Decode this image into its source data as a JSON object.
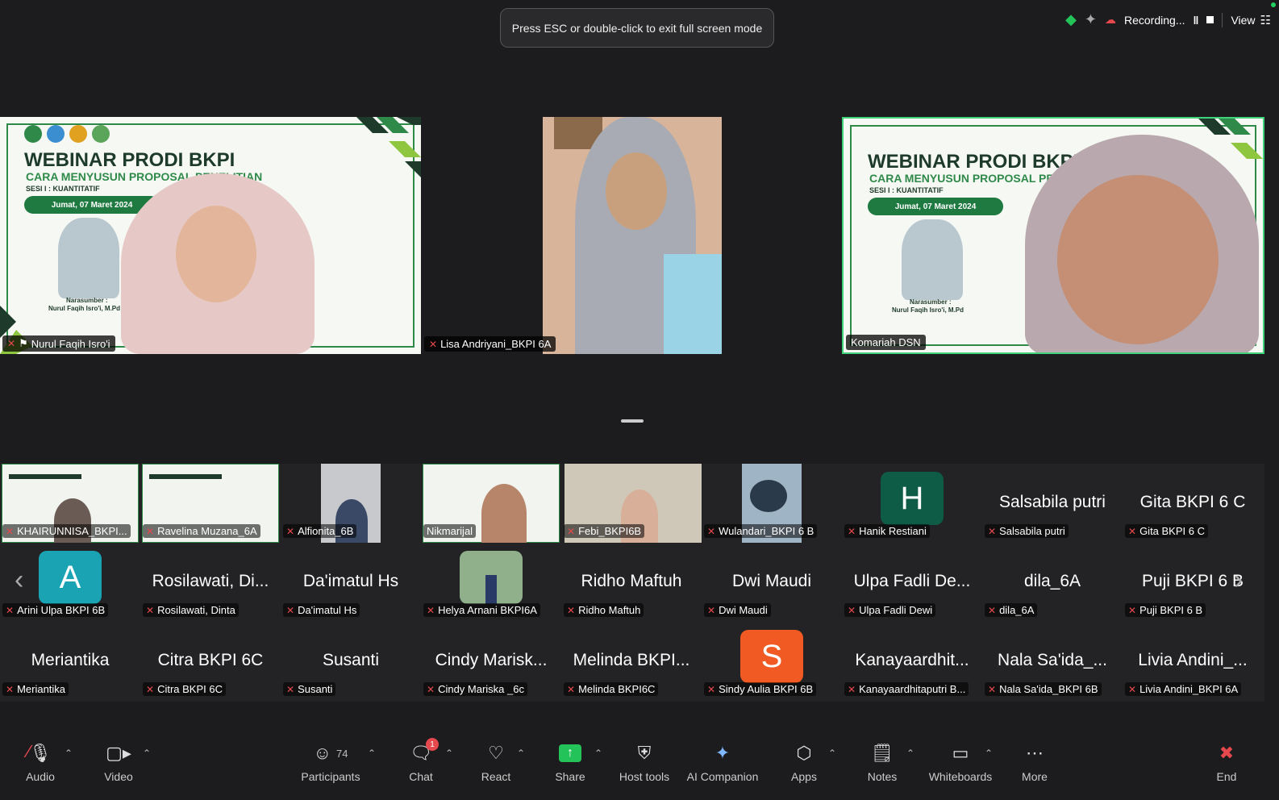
{
  "toast": "Press ESC or double-click to exit full screen mode",
  "top": {
    "recording": "Recording...",
    "view": "View"
  },
  "slide": {
    "title": "WEBINAR PRODI BKPI",
    "subtitle": "CARA MENYUSUN PROPOSAL PENELITIAN",
    "session": "SESI I : KUANTITATIF",
    "date": "Jumat, 07 Maret 2024",
    "speaker_role": "Narasumber :",
    "speaker": "Nurul Faqih Isro'i, M.Pd"
  },
  "main": [
    {
      "name": "Nurul Faqih Isro'i"
    },
    {
      "name": "Lisa Andriyani_BKPI 6A"
    },
    {
      "name": "Komariah DSN"
    }
  ],
  "row1": [
    {
      "label": "KHAIRUNNISA_BKPI..."
    },
    {
      "label": "Ravelina Muzana_6A"
    },
    {
      "label": "Alfionita_6B"
    },
    {
      "label": "Nikmarijal"
    },
    {
      "label": "Febi_BKPI6B"
    },
    {
      "label": "Wulandari_BKPI 6 B"
    },
    {
      "label": "Hanik Restiani",
      "avatar": "H"
    },
    {
      "label": "Salsabila putri",
      "big": "Salsabila putri"
    },
    {
      "label": "Gita BKPI 6 C",
      "big": "Gita BKPI 6 C"
    }
  ],
  "row2": [
    {
      "label": "Arini Ulpa BKPI 6B",
      "avatar": "A"
    },
    {
      "label": "Rosilawati, Dinta",
      "big": "Rosilawati, Di..."
    },
    {
      "label": "Da'imatul Hs",
      "big": "Da'imatul Hs"
    },
    {
      "label": "Helya Arnani BKPI6A"
    },
    {
      "label": "Ridho Maftuh",
      "big": "Ridho Maftuh"
    },
    {
      "label": "Dwi Maudi",
      "big": "Dwi Maudi"
    },
    {
      "label": "Ulpa Fadli Dewi",
      "big": "Ulpa Fadli De..."
    },
    {
      "label": "dila_6A",
      "big": "dila_6A"
    },
    {
      "label": "Puji BKPI 6 B",
      "big": "Puji BKPI 6 B"
    }
  ],
  "row3": [
    {
      "label": "Meriantika",
      "big": "Meriantika"
    },
    {
      "label": "Citra BKPI 6C",
      "big": "Citra BKPI 6C"
    },
    {
      "label": "Susanti",
      "big": "Susanti"
    },
    {
      "label": "Cindy Mariska _6c",
      "big": "Cindy Marisk..."
    },
    {
      "label": "Melinda BKPI6C",
      "big": "Melinda BKPI..."
    },
    {
      "label": "Sindy Aulia BKPI 6B",
      "avatar": "S"
    },
    {
      "label": "Kanayaardhitaputri B...",
      "big": "Kanayaardhit..."
    },
    {
      "label": "Nala Sa'ida_BKPI 6B",
      "big": "Nala Sa'ida_..."
    },
    {
      "label": "Livia Andini_BKPI 6A",
      "big": "Livia Andini_..."
    }
  ],
  "toolbar": {
    "audio": "Audio",
    "video": "Video",
    "participants": "Participants",
    "participants_count": "74",
    "chat": "Chat",
    "chat_badge": "1",
    "react": "React",
    "share": "Share",
    "host_tools": "Host tools",
    "ai_companion": "AI Companion",
    "apps": "Apps",
    "notes": "Notes",
    "whiteboards": "Whiteboards",
    "more": "More",
    "end": "End"
  },
  "colors": {
    "active_speaker": "#3fd27a",
    "share_green": "#23c35a",
    "end_red": "#e5484d",
    "avatar_h": "#0f5c46",
    "avatar_a": "#1aa3b3",
    "avatar_s": "#f15a22"
  }
}
